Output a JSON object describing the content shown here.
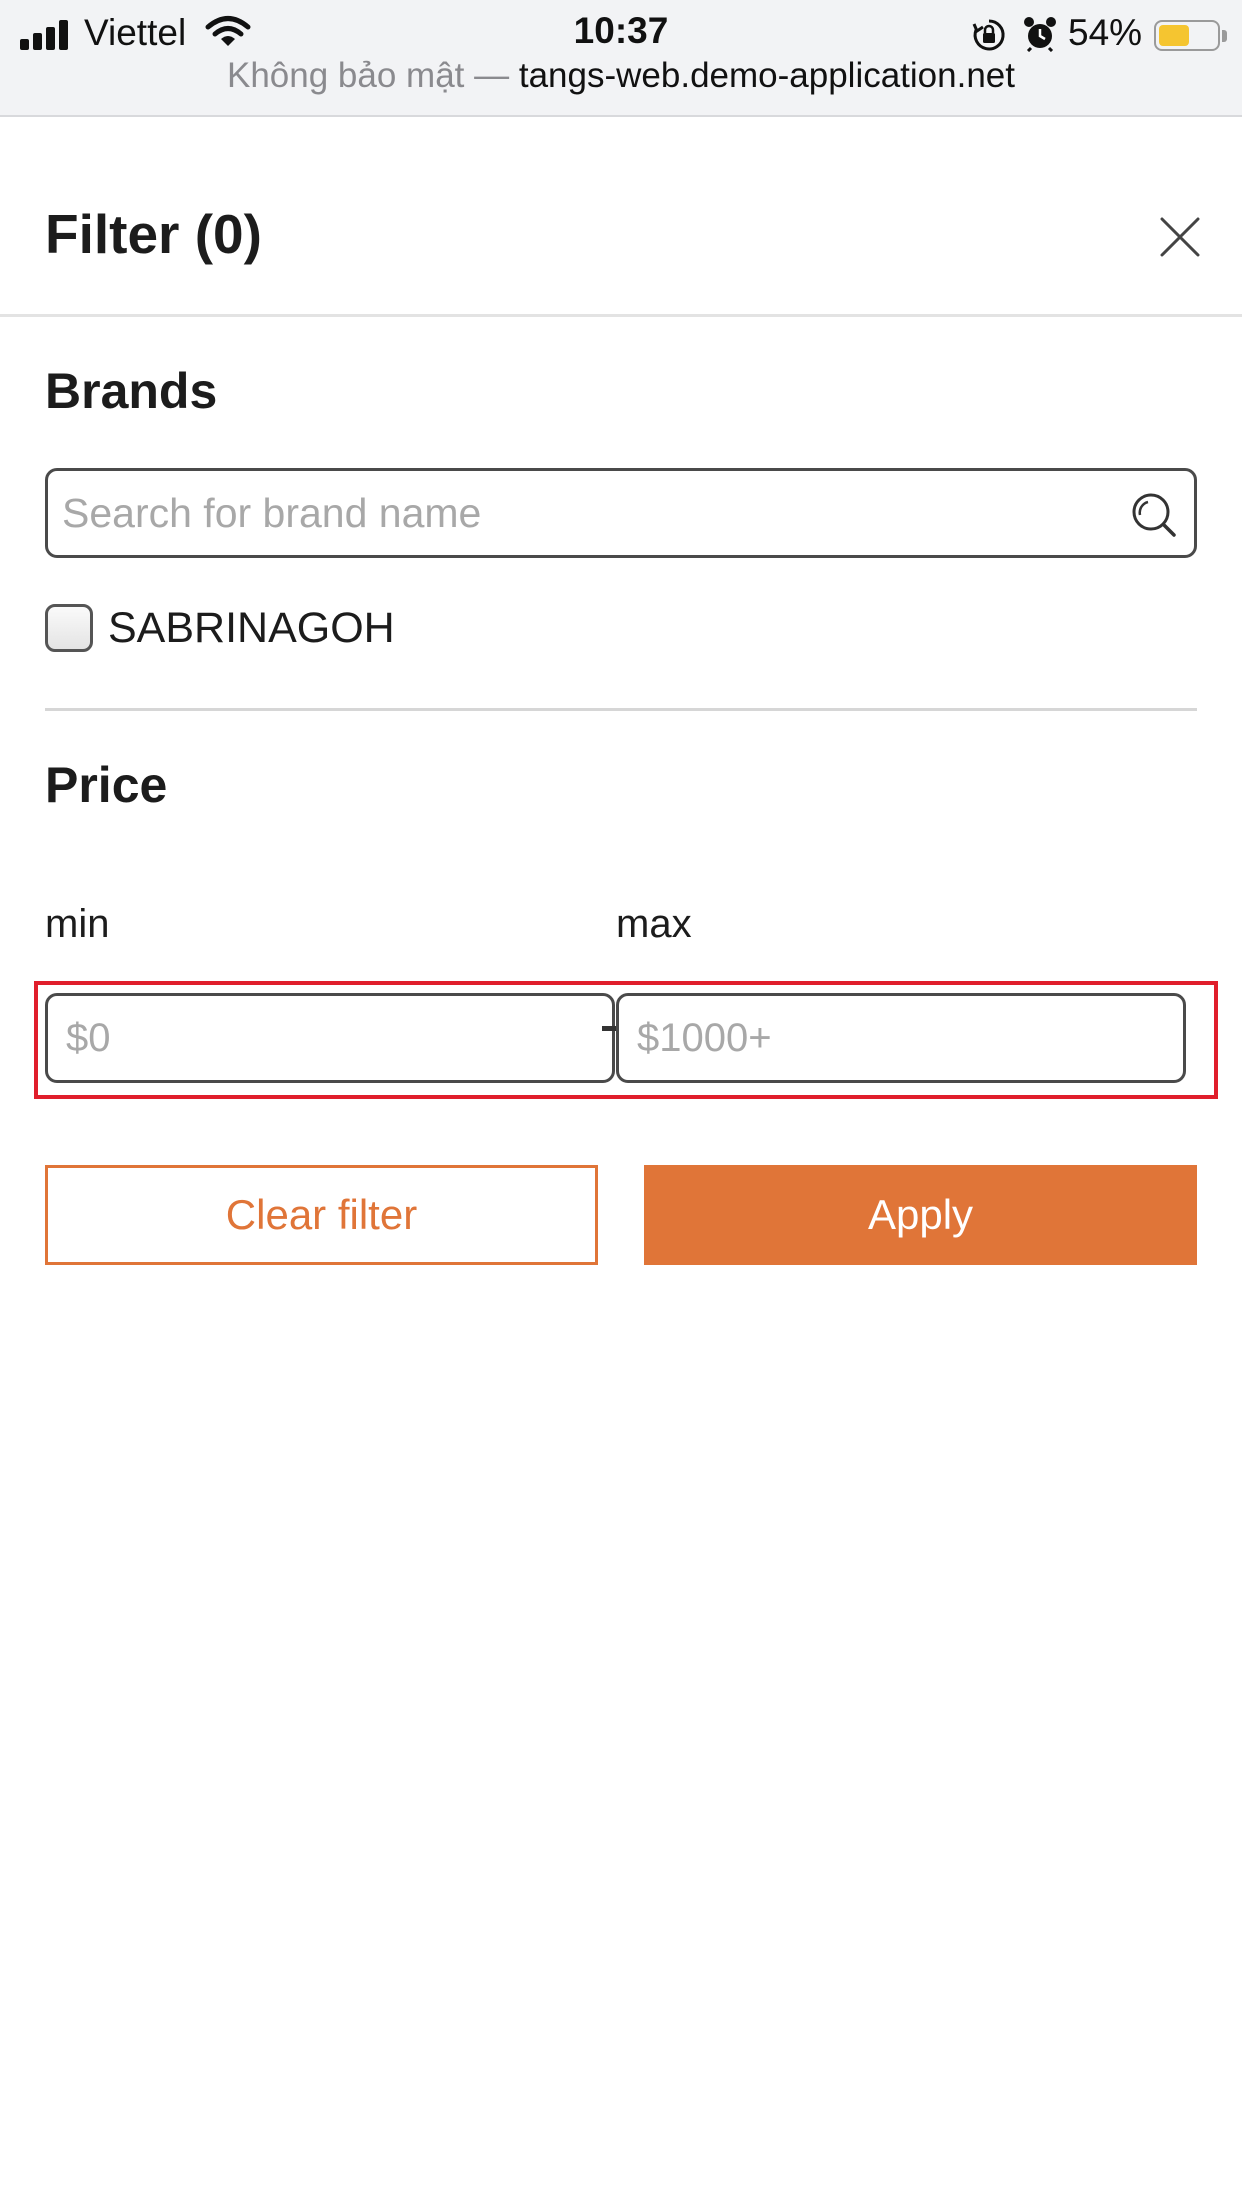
{
  "status_bar": {
    "carrier": "Viettel",
    "time": "10:37",
    "battery_percent": "54%",
    "battery_level": 0.54,
    "icons": [
      "signal-icon",
      "wifi-icon",
      "rotation-lock-icon",
      "alarm-icon",
      "battery-icon"
    ]
  },
  "url_bar": {
    "insecure_label": "Không bảo mật",
    "separator": " — ",
    "host": "tangs-web.demo-application.net"
  },
  "filter": {
    "title": "Filter (0)",
    "close_icon": "close-icon"
  },
  "brands": {
    "title": "Brands",
    "search_placeholder": "Search for brand name",
    "search_value": "",
    "search_icon": "search-icon",
    "options": [
      {
        "label": "SABRINAGOH",
        "checked": false
      }
    ]
  },
  "price": {
    "title": "Price",
    "min_label": "min",
    "max_label": "max",
    "min_placeholder": "$0",
    "max_placeholder": "$1000+",
    "min_value": "",
    "max_value": ""
  },
  "actions": {
    "clear_label": "Clear filter",
    "apply_label": "Apply"
  },
  "colors": {
    "accent": "#e07538",
    "highlight": "#e01e2b",
    "battery_fill": "#f5c530"
  }
}
